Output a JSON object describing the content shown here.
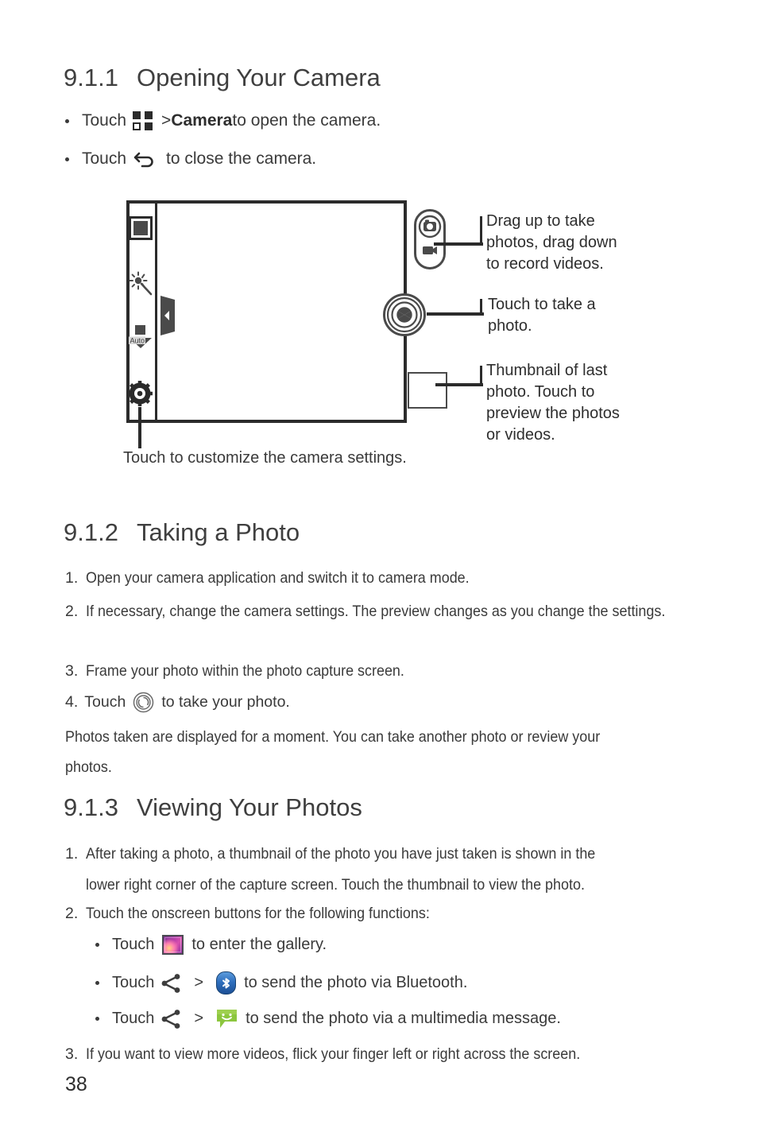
{
  "document": {
    "page_number": "38"
  },
  "sections": [
    {
      "number": "9.1.1",
      "title": "Opening Your Camera"
    },
    {
      "number": "9.1.2",
      "title": "Taking a Photo"
    },
    {
      "number": "9.1.3",
      "title": "Viewing Your Photos"
    }
  ],
  "s911": {
    "bullets": [
      {
        "pre": "Touch",
        "icon": "app-launcher-grid-icon",
        "mid": "> ",
        "bold": "Camera",
        "post": " to open the camera."
      },
      {
        "pre": "Touch",
        "icon": "back-arrow-icon",
        "post": "to close the camera."
      }
    ],
    "diagram": {
      "caption": "Touch to customize the camera settings.",
      "annotations": [
        "Drag up to take\nphotos, drag down\nto record videos.",
        "Touch to take a\nphoto.",
        "Thumbnail of last\nphoto. Touch to\npreview the photos\nor videos."
      ],
      "annotation_1_lines": [
        "Drag up to take",
        "photos, drag down",
        "to record videos."
      ],
      "annotation_2_lines": [
        "Touch to take a",
        "photo."
      ],
      "annotation_3_lines": [
        "Thumbnail of last",
        "photo. Touch to",
        "preview the photos",
        "or videos."
      ],
      "sidebar_icons": [
        "photo-mode-icon",
        "brightness-wand-icon",
        "white-balance-auto-icon",
        "settings-gear-icon"
      ],
      "wb_label": "Auto",
      "right_controls": [
        "mode-toggle-camera-video",
        "shutter-button",
        "last-photo-thumbnail"
      ],
      "preview_handle": "preview-drawer-handle"
    }
  },
  "s912": {
    "steps": [
      {
        "n": "1.",
        "text": "Open your camera application and switch it to camera mode."
      },
      {
        "n": "2.",
        "text": "If necessary, change the camera settings. The preview changes as you change the settings."
      },
      {
        "n": "3.",
        "text": "Frame your photo within the photo capture screen."
      }
    ],
    "step4": {
      "n": "4.",
      "pre": "Touch",
      "icon": "shutter-button-icon",
      "post": "to take your photo."
    },
    "closing_lines": [
      "Photos taken are displayed for a moment. You can take another photo or review your",
      "photos."
    ]
  },
  "s913": {
    "steps": [
      {
        "n": "1.",
        "line1": "After taking a photo, a thumbnail of the photo you have just taken is shown in the",
        "line2": "lower right corner of the capture screen. Touch the thumbnail to view the photo."
      },
      {
        "n": "2.",
        "line1": "Touch the onscreen buttons for the following functions:"
      }
    ],
    "bullets": [
      {
        "pre": "Touch",
        "icon": "gallery-icon",
        "post": "to enter the gallery."
      },
      {
        "pre": "Touch",
        "icon": "share-icon",
        "mid": ">",
        "icon2": "bluetooth-icon",
        "post": "to send the photo via Bluetooth."
      },
      {
        "pre": "Touch",
        "icon": "share-icon",
        "mid": ">",
        "icon2": "messaging-icon",
        "post": "to send the photo via a multimedia message."
      }
    ],
    "step3": {
      "n": "3.",
      "text": "If you want to view more videos, flick your finger left or right across the screen."
    }
  },
  "colors": {
    "text": "#3a3a3a",
    "heading": "#3f3f3f",
    "diagram_stroke": "#2b2b2b",
    "icon_gray": "#4a4a4a",
    "bluetooth_blue": "#2f6fbe",
    "messaging_green": "#8cc63e",
    "gallery_magenta": "#b23ca8"
  }
}
